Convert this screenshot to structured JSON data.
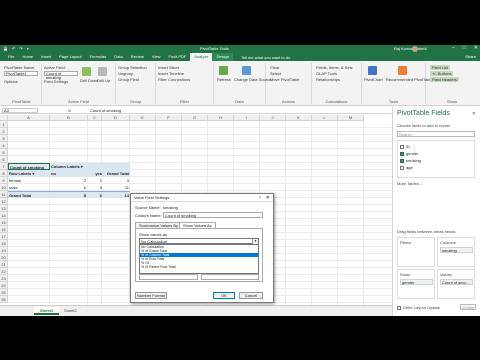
{
  "window": {
    "title": "PivotTable Tools",
    "file_name": "Book1 - Excel",
    "user": "Raj Kumar Subedi",
    "controls": [
      "–",
      "□",
      "✕"
    ]
  },
  "qat": [
    "💾",
    "↶",
    "↷",
    "▾"
  ],
  "ribbon_tabs": [
    "File",
    "Home",
    "Insert",
    "Page Layout",
    "Formulas",
    "Data",
    "Review",
    "View",
    "Foxit PDF",
    "Analyze",
    "Design"
  ],
  "tell_me": "Tell me what you want to do",
  "share": "Share",
  "ribbon": {
    "pivot_name_label": "PivotTable Name:",
    "pivot_name_value": "PivotTable1",
    "options_label": "Options",
    "active_field_label": "Active Field:",
    "active_field_value": "Count of smoking",
    "field_settings": "Field Settings",
    "drill_down": "Drill Down",
    "drill_up": "Drill Up",
    "group_selection": "Group Selection",
    "ungroup": "Ungroup",
    "group_field": "Group Field",
    "insert_slicer": "Insert Slicer",
    "insert_timeline": "Insert Timeline",
    "filter_connections": "Filter Connections",
    "refresh": "Refresh",
    "change_data_source": "Change Data Source",
    "clear": "Clear",
    "select": "Select",
    "move_pivottable": "Move PivotTable",
    "fields_items_sets": "Fields, Items, & Sets",
    "olap_tools": "OLAP Tools",
    "relationships": "Relationships",
    "pivotchart": "PivotChart",
    "recommended": "Recommended PivotTables",
    "field_list": "Field List",
    "buttons": "+/- Buttons",
    "field_headers": "Field Headers",
    "groups": [
      "PivotTable",
      "Active Field",
      "Group",
      "Filter",
      "Data",
      "Actions",
      "Calculations",
      "Tools",
      "Show"
    ]
  },
  "formula_bar": {
    "name_box": "A3",
    "fx": "fx",
    "formula": "Count of smoking"
  },
  "grid": {
    "columns": [
      "A",
      "B",
      "C",
      "D",
      "E",
      "F",
      "G",
      "H",
      "I",
      "J",
      "K",
      "L",
      "M"
    ],
    "rows": [
      "1",
      "2",
      "3",
      "4",
      "5",
      "6",
      "7",
      "8",
      "9",
      "10",
      "11",
      "12",
      "13",
      "14",
      "15",
      "16",
      "17",
      "18",
      "19",
      "20",
      "21",
      "22",
      "23",
      "24",
      "25",
      "26"
    ],
    "pivot": {
      "a3": "Count of smoking",
      "b3": "Column Labels",
      "b3_arrow": "▾",
      "a4": "Row Labels",
      "a4_arrow": "▾",
      "b4": "no",
      "c4": "yes",
      "d4": "Grand Total",
      "rows": [
        {
          "label": "female",
          "no": "2",
          "yes": "1",
          "total": "3"
        },
        {
          "label": "male",
          "no": "6",
          "yes": "5",
          "total": "11"
        },
        {
          "label": "Grand Total",
          "no": "8",
          "yes": "6",
          "total": "14"
        }
      ]
    }
  },
  "sheet_tabs": [
    "Sheet1",
    "Sheet2"
  ],
  "pane": {
    "title": "PivotTable Fields",
    "close": "✕",
    "subtitle": "Choose fields to add to report:",
    "search_placeholder": "Search",
    "fields": [
      {
        "name": "ID",
        "checked": false
      },
      {
        "name": "gender",
        "checked": true
      },
      {
        "name": "smoking",
        "checked": true
      },
      {
        "name": "age",
        "checked": false
      }
    ],
    "more_tables": "More Tables...",
    "drag_text": "Drag fields between areas below:",
    "areas": {
      "filters": "Filters",
      "columns": "Columns",
      "rows": "Rows",
      "values": "Values",
      "columns_chip": "smoking",
      "rows_chip": "gender",
      "values_chip": "Count of smo..."
    },
    "defer_label": "Defer Layout Update",
    "update": "Update"
  },
  "dialog": {
    "title": "Value Field Settings",
    "help": "?",
    "close": "✕",
    "source_label": "Source Name:",
    "source_value": "smoking",
    "custom_label": "Custom Name:",
    "custom_value": "Count of smoking",
    "tab_summarize": "Summarize Values By",
    "tab_show": "Show Values As",
    "show_as_label": "Show values as",
    "selected_option": "No Calculation",
    "options": [
      "No Calculation",
      "% of Grand Total",
      "% of Column Total",
      "% of Row Total",
      "% Of",
      "% of Parent Row Total"
    ],
    "highlighted_index": 2,
    "number_format": "Number Format",
    "ok": "OK",
    "cancel": "Cancel"
  },
  "colors": {
    "excel_green": "#217346",
    "selection_blue": "#0078d7",
    "pivot_header": "#dce6f1"
  }
}
